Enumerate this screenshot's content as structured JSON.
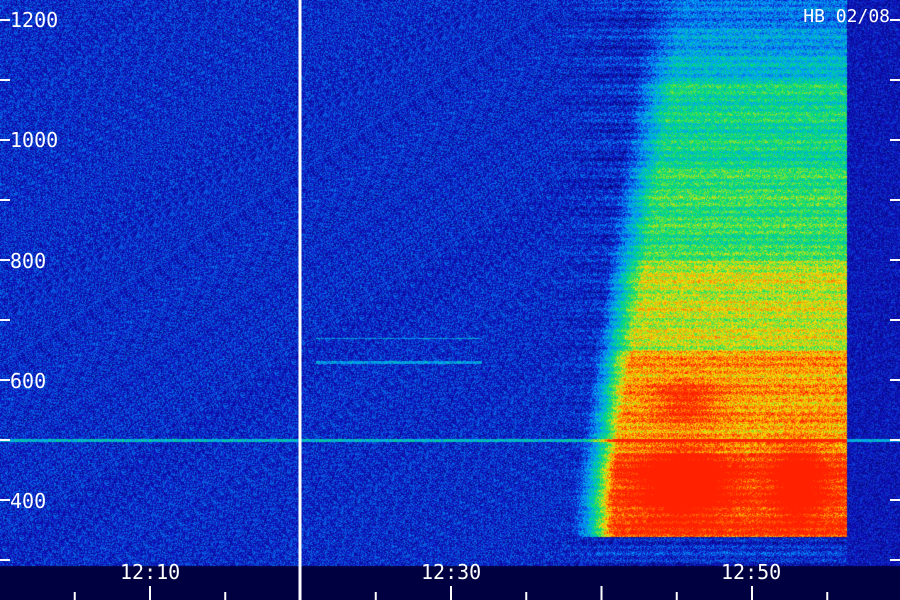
{
  "chart_data": {
    "type": "heatmap",
    "title": "",
    "annotation": "HB 02/08",
    "xlabel": "",
    "ylabel": "",
    "x_tick_labels": [
      "12:10",
      "12:30",
      "12:50"
    ],
    "y_tick_labels": [
      "400",
      "600",
      "800",
      "1000",
      "1200"
    ],
    "ylim": [
      300,
      1300
    ],
    "xlim_minutes_after_noon": [
      0,
      60
    ],
    "data_gap_marker_time": "12:20",
    "colormap": [
      "#000040",
      "#1010c0",
      "#00a0ff",
      "#00e070",
      "#ffe000",
      "#ff2000"
    ],
    "regions": [
      {
        "t_start": "12:40",
        "t_end": "12:56",
        "f_low": 340,
        "f_high": 1250,
        "level": "medium"
      },
      {
        "t_start": "12:41",
        "t_end": "12:56",
        "f_low": 360,
        "f_high": 820,
        "level": "high"
      },
      {
        "t_start": "12:42",
        "t_end": "12:56",
        "f_low": 380,
        "f_high": 480,
        "level": "very-high"
      },
      {
        "t_start": "12:44",
        "t_end": "12:48",
        "f_low": 520,
        "f_high": 620,
        "level": "high"
      }
    ],
    "notable_lines_hz": [
      500,
      630,
      670
    ]
  }
}
